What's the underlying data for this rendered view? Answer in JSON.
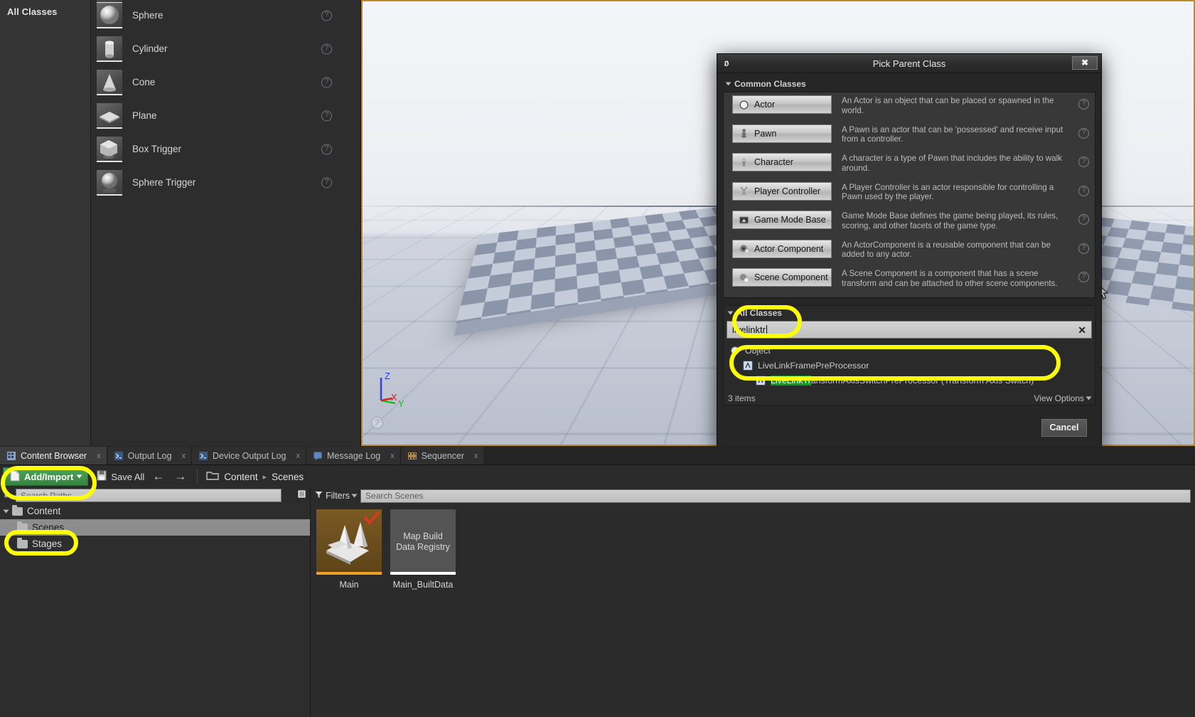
{
  "place_actors": {
    "tab_label": "All Classes",
    "items": [
      {
        "name": "Sphere",
        "icon": "sphere-thumb"
      },
      {
        "name": "Cylinder",
        "icon": "cylinder-thumb"
      },
      {
        "name": "Cone",
        "icon": "cone-thumb"
      },
      {
        "name": "Plane",
        "icon": "plane-thumb"
      },
      {
        "name": "Box Trigger",
        "icon": "box-trigger-thumb"
      },
      {
        "name": "Sphere Trigger",
        "icon": "sphere-trigger-thumb"
      }
    ],
    "help_glyph": "?"
  },
  "viewport": {
    "axis_z": "Z",
    "axis_x": "X",
    "axis_y": "Y",
    "help_glyph": "?"
  },
  "dialog": {
    "title": "Pick Parent Class",
    "close_glyph": "✖",
    "common_section": "Common Classes",
    "all_section": "All Classes",
    "help_glyph": "?",
    "classes": [
      {
        "label": "Actor",
        "icon": "actor-icon",
        "desc": "An Actor is an object that can be placed or spawned in the world."
      },
      {
        "label": "Pawn",
        "icon": "pawn-icon",
        "desc": "A Pawn is an actor that can be 'possessed' and receive input from a controller."
      },
      {
        "label": "Character",
        "icon": "character-icon",
        "desc": "A character is a type of Pawn that includes the ability to walk around."
      },
      {
        "label": "Player Controller",
        "icon": "player-controller-icon",
        "desc": "A Player Controller is an actor responsible for controlling a Pawn used by the player."
      },
      {
        "label": "Game Mode Base",
        "icon": "game-mode-icon",
        "desc": "Game Mode Base defines the game being played, its rules, scoring, and other facets of the game type."
      },
      {
        "label": "Actor Component",
        "icon": "actor-component-icon",
        "desc": "An ActorComponent is a reusable component that can be added to any actor."
      },
      {
        "label": "Scene Component",
        "icon": "scene-component-icon",
        "desc": "A Scene Component is a component that has a scene transform and can be attached to other scene components."
      }
    ],
    "search": {
      "value": "livelinktr",
      "clear_glyph": "✕"
    },
    "tree": [
      {
        "label": "Object",
        "icon": "object-icon",
        "indent": 0,
        "highlight": "",
        "rest": "Object"
      },
      {
        "label": "LiveLinkFramePreProcessor",
        "icon": "blueprint-icon",
        "indent": 1,
        "highlight": "",
        "rest": "LiveLinkFramePreProcessor"
      },
      {
        "label": "LiveLinkTransformAxisSwitchPreProcessor (Transform Axis Switch)",
        "icon": "blueprint-icon",
        "indent": 2,
        "highlight": "LiveLinkTr",
        "rest": "ansformAxisSwitchPreProcessor (Transform Axis Switch)"
      }
    ],
    "items_count": "3 items",
    "view_options": "View Options",
    "cancel_label": "Cancel"
  },
  "content_browser": {
    "tabs": [
      {
        "label": "Content Browser",
        "icon": "content-browser-icon",
        "active": true
      },
      {
        "label": "Output Log",
        "icon": "output-log-icon",
        "active": false
      },
      {
        "label": "Device Output Log",
        "icon": "device-output-log-icon",
        "active": false
      },
      {
        "label": "Message Log",
        "icon": "message-log-icon",
        "active": false
      },
      {
        "label": "Sequencer",
        "icon": "sequencer-icon",
        "active": false
      }
    ],
    "tab_close_glyph": "x",
    "toolbar": {
      "add_import": "Add/Import",
      "save_all": "Save All",
      "back_glyph": "←",
      "forward_glyph": "→"
    },
    "breadcrumb": [
      "Content",
      "Scenes"
    ],
    "breadcrumb_sep": "▸",
    "paths": {
      "placeholder": "Search Paths",
      "tree": [
        {
          "label": "Content",
          "depth": 0,
          "selected": false,
          "expanded": true
        },
        {
          "label": "Scenes",
          "depth": 1,
          "selected": true,
          "expanded": false
        },
        {
          "label": "Stages",
          "depth": 1,
          "selected": false,
          "expanded": false
        }
      ]
    },
    "assets": {
      "filters_label": "Filters",
      "search_placeholder": "Search Scenes",
      "items": [
        {
          "label": "Main",
          "thumb": "level-thumb",
          "accent": "#f0a020",
          "modified": true
        },
        {
          "label": "Main_BuiltData",
          "thumb": "text-thumb",
          "text": "Map Build\nData Registry",
          "accent": "#ffffff",
          "modified": false
        }
      ]
    }
  },
  "annotations": {
    "color": "#fdfd0a",
    "regions": [
      "search-field",
      "result-row",
      "add-import-button",
      "stages-folder"
    ]
  }
}
